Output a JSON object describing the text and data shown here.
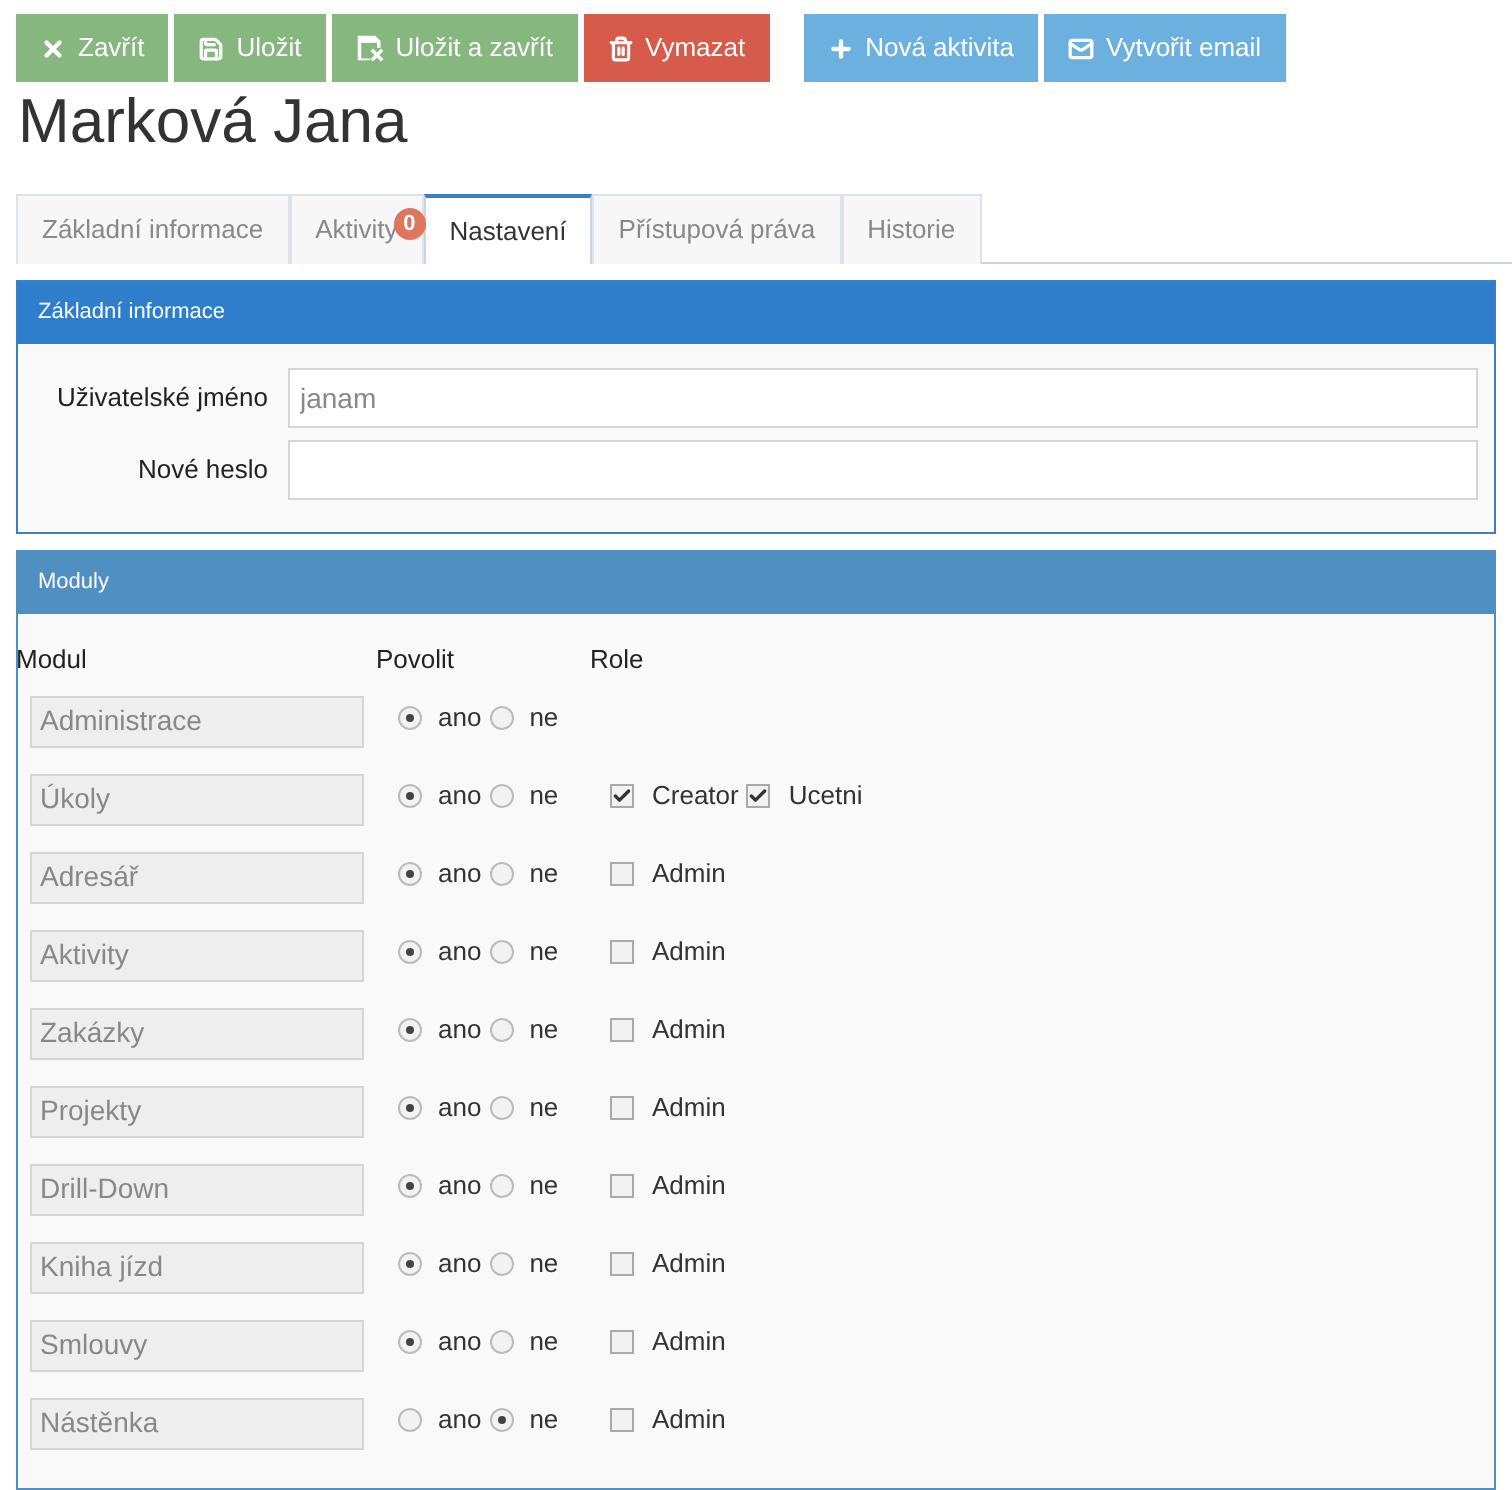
{
  "toolbar": [
    {
      "label": "Zavřít",
      "kind": "close",
      "color": "#86b77e"
    },
    {
      "label": "Uložit",
      "kind": "save",
      "color": "#86b77e"
    },
    {
      "label": "Uložit a zavřít",
      "kind": "save-close",
      "color": "#86b77e"
    },
    {
      "label": "Vymazat",
      "kind": "delete",
      "color": "#d65b4a"
    },
    {
      "label": "Nová aktivita",
      "kind": "add",
      "color": "#6cb0e0"
    },
    {
      "label": "Vytvořit email",
      "kind": "email",
      "color": "#6cb0e0"
    }
  ],
  "title": "Marková Jana",
  "tabs": [
    {
      "label": "Základní informace",
      "selected": false
    },
    {
      "label": "Aktivity",
      "badge": "0",
      "selected": false
    },
    {
      "label": "Nastavení",
      "selected": true
    },
    {
      "label": "Přístupová práva",
      "selected": false
    },
    {
      "label": "Historie",
      "selected": false
    }
  ],
  "basic_panel": {
    "title": "Základní informace",
    "fields": [
      {
        "label": "Uživatelské jméno",
        "value": "janam"
      },
      {
        "label": "Nové heslo"
      }
    ]
  },
  "modules_panel": {
    "title": "Moduly",
    "columns": [
      "Modul",
      "Povolit",
      "Role"
    ],
    "rows": [
      {
        "name": "Administrace",
        "options": [
          {
            "label": "ano",
            "selected": true
          },
          {
            "label": "ne",
            "selected": false
          }
        ],
        "roles": []
      },
      {
        "name": "Úkoly",
        "options": [
          {
            "label": "ano",
            "selected": true
          },
          {
            "label": "ne",
            "selected": false
          }
        ],
        "roles": [
          {
            "label": "Creator",
            "checked": true
          },
          {
            "label": "Ucetni",
            "checked": true
          }
        ]
      },
      {
        "name": "Adresář",
        "options": [
          {
            "label": "ano",
            "selected": true
          },
          {
            "label": "ne",
            "selected": false
          }
        ],
        "roles": [
          {
            "label": "Admin",
            "checked": false
          }
        ]
      },
      {
        "name": "Aktivity",
        "options": [
          {
            "label": "ano",
            "selected": true
          },
          {
            "label": "ne",
            "selected": false
          }
        ],
        "roles": [
          {
            "label": "Admin",
            "checked": false
          }
        ]
      },
      {
        "name": "Zakázky",
        "options": [
          {
            "label": "ano",
            "selected": true
          },
          {
            "label": "ne",
            "selected": false
          }
        ],
        "roles": [
          {
            "label": "Admin",
            "checked": false
          }
        ]
      },
      {
        "name": "Projekty",
        "options": [
          {
            "label": "ano",
            "selected": true
          },
          {
            "label": "ne",
            "selected": false
          }
        ],
        "roles": [
          {
            "label": "Admin",
            "checked": false
          }
        ]
      },
      {
        "name": "Drill-Down",
        "options": [
          {
            "label": "ano",
            "selected": true
          },
          {
            "label": "ne",
            "selected": false
          }
        ],
        "roles": [
          {
            "label": "Admin",
            "checked": false
          }
        ]
      },
      {
        "name": "Kniha jízd",
        "options": [
          {
            "label": "ano",
            "selected": true
          },
          {
            "label": "ne",
            "selected": false
          }
        ],
        "roles": [
          {
            "label": "Admin",
            "checked": false
          }
        ]
      },
      {
        "name": "Smlouvy",
        "options": [
          {
            "label": "ano",
            "selected": true
          },
          {
            "label": "ne",
            "selected": false
          }
        ],
        "roles": [
          {
            "label": "Admin",
            "checked": false
          }
        ]
      },
      {
        "name": "Nástěnka",
        "options": [
          {
            "label": "ano",
            "selected": false
          },
          {
            "label": "ne",
            "selected": true
          }
        ],
        "roles": [
          {
            "label": "Admin",
            "checked": false
          }
        ]
      }
    ]
  }
}
